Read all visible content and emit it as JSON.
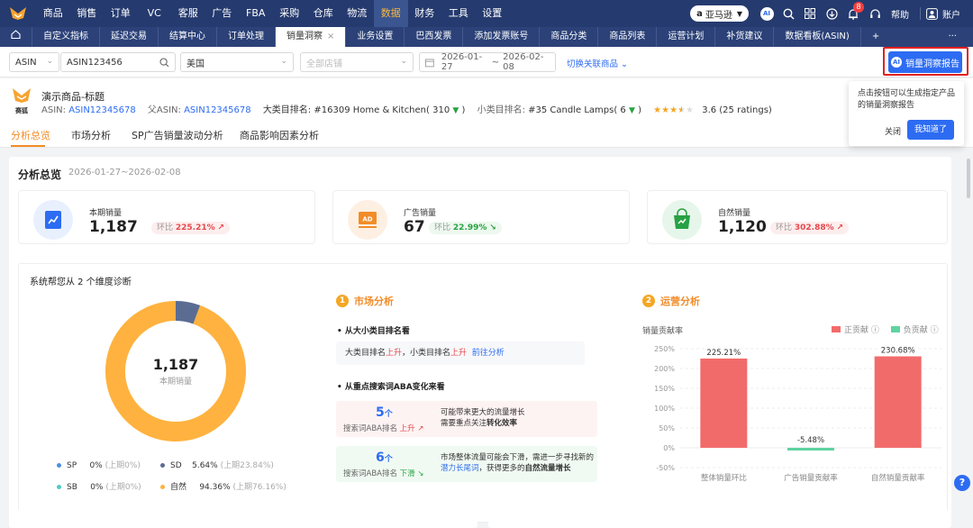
{
  "topnav": {
    "menu": [
      "商品",
      "销售",
      "订单",
      "VC",
      "客服",
      "广告",
      "FBA",
      "采购",
      "仓库",
      "物流",
      "数据",
      "财务",
      "工具",
      "设置"
    ],
    "active_menu": "数据",
    "marketplace": "亚马逊",
    "ai_label": "AI",
    "notification_count": "8",
    "help_label": "帮助",
    "account_label": "账户"
  },
  "tabs": {
    "items": [
      "自定义指标",
      "延迟交易",
      "结算中心",
      "订单处理",
      "销量洞察",
      "业务设置",
      "巴西发票",
      "添加发票账号",
      "商品分类",
      "商品列表",
      "运营计划",
      "补货建议",
      "数据看板(ASIN)"
    ],
    "active": "销量洞察",
    "add_label": "+",
    "more_label": "···"
  },
  "filters": {
    "type_value": "ASIN",
    "search_value": "ASIN123456",
    "country_value": "美国",
    "store_placeholder": "全部店铺",
    "date_start": "2026-01-27",
    "date_sep": "~",
    "date_end": "2026-02-08",
    "switch_link": "切换关联商品",
    "insight_button": "销量洞察报告"
  },
  "popover": {
    "text": "点击按钮可以生成指定产品的销量洞察报告",
    "close_label": "关闭",
    "ok_label": "我知道了"
  },
  "product": {
    "title": "演示商品-标题",
    "thumb_label": "赛狐",
    "asin_label": "ASIN:",
    "asin": "ASIN12345678",
    "parent_label": "父ASIN:",
    "parent_asin": "ASIN12345678",
    "cat_rank_label": "大类目排名:",
    "cat_rank": "#16309 Home & Kitchen( 310",
    "sub_rank_label": "小类目排名:",
    "sub_rank": "#35 Candle Lamps( 6",
    "rating": 3.6,
    "rating_text": "3.6 (25 ratings)"
  },
  "subtabs": [
    "分析总览",
    "市场分析",
    "SP广告销量波动分析",
    "商品影响因素分析"
  ],
  "overview": {
    "title": "分析总览",
    "date_range": "2026-01-27~2026-02-08",
    "cards": [
      {
        "label": "本期销量",
        "value": "1,187",
        "chg_label": "环比",
        "chg": "225.21%",
        "dir": "up",
        "icon": "chart-icon",
        "color": "#2d6cf2"
      },
      {
        "label": "广告销量",
        "value": "67",
        "chg_label": "环比",
        "chg": "22.99%",
        "dir": "down",
        "icon": "ad-icon",
        "color": "#f28c28"
      },
      {
        "label": "自然销量",
        "value": "1,120",
        "chg_label": "环比",
        "chg": "302.88%",
        "dir": "up",
        "icon": "bag-icon",
        "color": "#27a243"
      }
    ]
  },
  "diagnosis": {
    "title": "系统帮您从 2 个维度诊断",
    "donut_value": "1,187",
    "donut_label": "本期销量",
    "legend": [
      {
        "name": "SP",
        "pct": "0%",
        "prev": "(上期0%)",
        "color": "#4a90e2"
      },
      {
        "name": "SD",
        "pct": "5.64%",
        "prev": "(上期23.84%)",
        "color": "#5b6c93"
      },
      {
        "name": "SB",
        "pct": "0%",
        "prev": "(上期0%)",
        "color": "#4ecdc4"
      },
      {
        "name": "自然",
        "pct": "94.36%",
        "prev": "(上期76.16%)",
        "color": "#ffb23f"
      }
    ],
    "market": {
      "num": "1",
      "title": "市场分析",
      "b1": "从大小类目排名看",
      "line_a": "大类目排名",
      "line_b": "上升",
      "line_c": "，小类目排名",
      "line_d": "上升",
      "line_link": "前往分析",
      "b2": "从重点搜索词ABA变化来看",
      "kw_up_num": "5",
      "kw_up_unit": "个",
      "kw_up_label": "搜索词ABA排名",
      "kw_up_dir": "上升",
      "kw_up_text_a": "可能带来更大的流量增长",
      "kw_up_text_b": "需要重点关注",
      "kw_up_text_c": "转化效率",
      "kw_down_num": "6",
      "kw_down_unit": "个",
      "kw_down_label": "搜索词ABA排名",
      "kw_down_dir": "下滑",
      "kw_down_text_a": "市场整体流量可能会下滑，需进一步寻找新的",
      "kw_down_text_b": "潜力长尾词",
      "kw_down_text_c": "，获得更多的",
      "kw_down_text_d": "自然流量增长"
    },
    "ops": {
      "num": "2",
      "title": "运营分析",
      "chart_title": "销量贡献率",
      "legend_pos": "正贡献",
      "legend_neg": "负贡献",
      "pos_color": "#f26b6b",
      "neg_color": "#5fd3a0"
    }
  },
  "chart_data": {
    "type": "bar",
    "title": "销量贡献率",
    "categories": [
      "整体销量环比",
      "广告销量贡献率",
      "自然销量贡献率"
    ],
    "values": [
      225.21,
      -5.48,
      230.68
    ],
    "value_labels": [
      "225.21%",
      "-5.48%",
      "230.68%"
    ],
    "yticks": [
      "250%",
      "200%",
      "150%",
      "100%",
      "50%",
      "0%",
      "-50%"
    ],
    "ylim": [
      -50,
      250
    ],
    "series": [
      {
        "name": "正贡献"
      },
      {
        "name": "负贡献"
      }
    ],
    "grid": true,
    "legend": "top-right"
  }
}
